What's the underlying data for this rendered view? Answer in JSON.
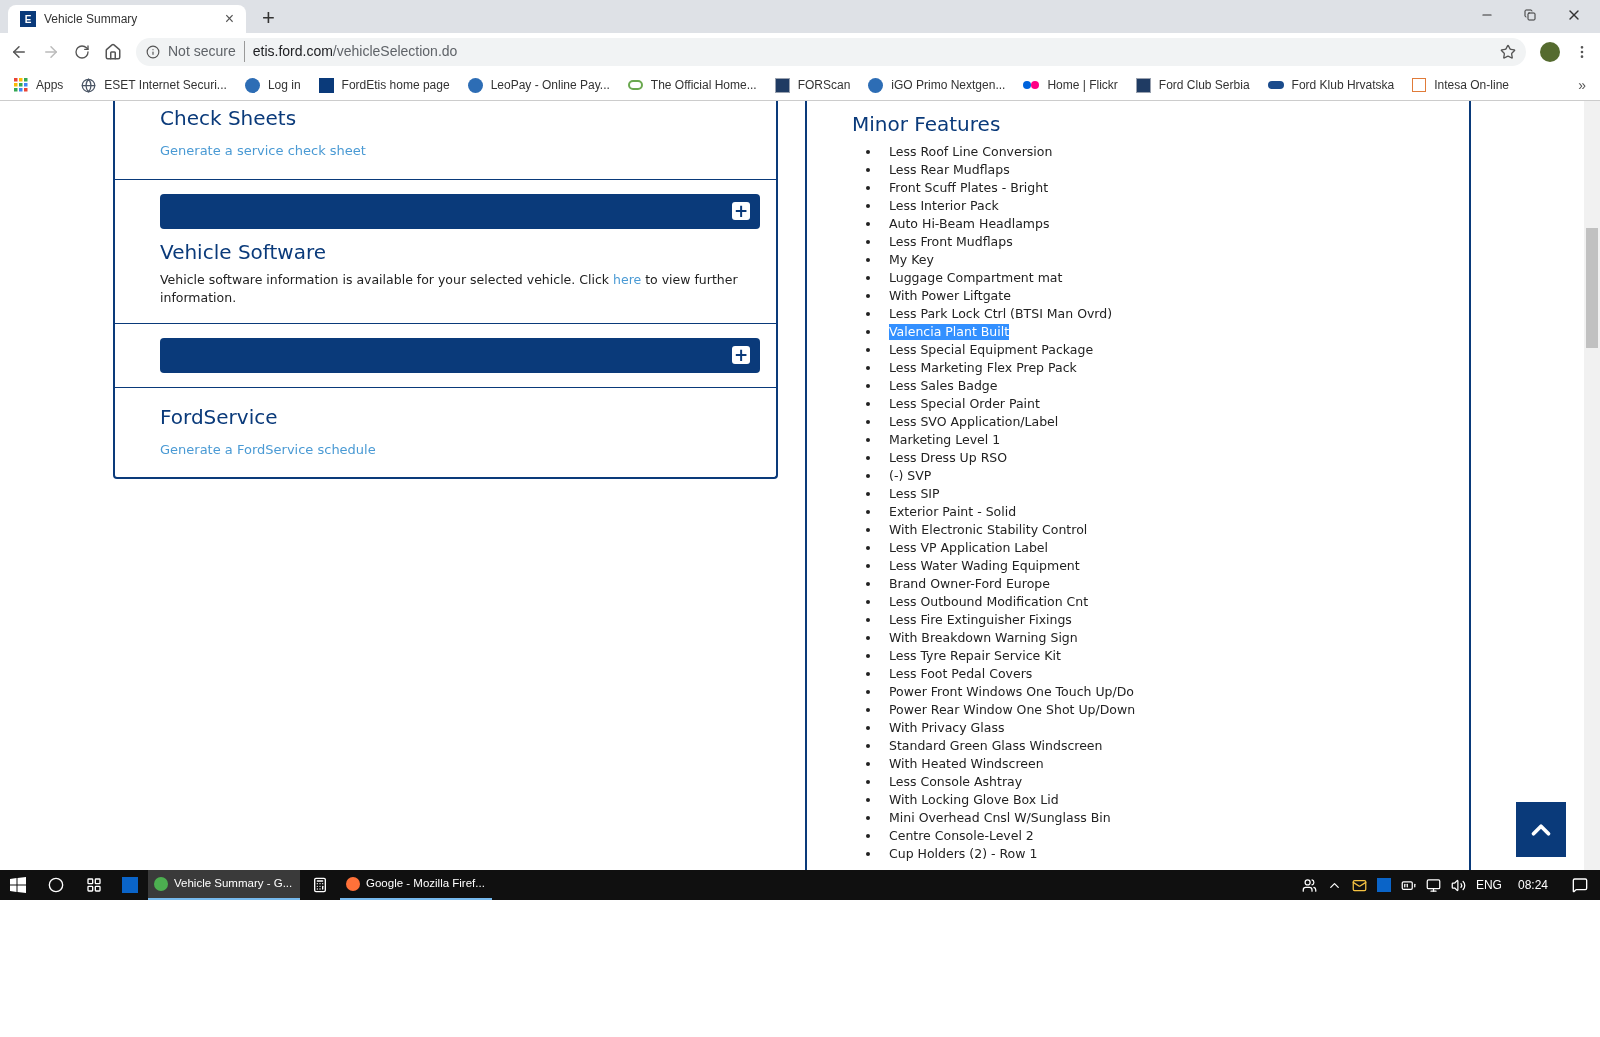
{
  "browser": {
    "tab": {
      "favicon": "E",
      "title": "Vehicle Summary",
      "close": "×"
    },
    "new_tab": "+",
    "address": {
      "security": "Not secure",
      "host": "etis.ford.com",
      "path": "/vehicleSelection.do"
    },
    "bookmarks": [
      {
        "label": "Apps",
        "kind": "grid"
      },
      {
        "label": "ESET Internet Securi...",
        "kind": "globe"
      },
      {
        "label": "Log in",
        "kind": "circle"
      },
      {
        "label": "FordEtis home page",
        "kind": "letter"
      },
      {
        "label": "LeoPay - Online Pay...",
        "kind": "circle"
      },
      {
        "label": "The Official Home...",
        "kind": "leaf"
      },
      {
        "label": "FORScan",
        "kind": "square"
      },
      {
        "label": "iGO Primo Nextgen...",
        "kind": "circle"
      },
      {
        "label": "Home | Flickr",
        "kind": "dots"
      },
      {
        "label": "Ford Club Serbia",
        "kind": "square"
      },
      {
        "label": "Ford Klub Hrvatska",
        "kind": "oval"
      },
      {
        "label": "Intesa On-line",
        "kind": "outline"
      }
    ],
    "more": "»"
  },
  "left_panel": {
    "sections": [
      {
        "kind": "link",
        "title": "Check Sheets",
        "link": "Generate a service check sheet"
      },
      {
        "kind": "bar",
        "expand": "+"
      },
      {
        "kind": "text",
        "title": "Vehicle Software",
        "before": "Vehicle software information is available for your selected vehicle. Click ",
        "link": "here",
        "after": " to view further information."
      },
      {
        "kind": "bar",
        "expand": "+"
      },
      {
        "kind": "link",
        "title": "FordService",
        "link": "Generate a FordService schedule"
      }
    ]
  },
  "right_panel": {
    "title": "Minor Features",
    "items": [
      {
        "label": "Less Roof Line Conversion",
        "highlighted": false
      },
      {
        "label": "Less Rear Mudflaps",
        "highlighted": false
      },
      {
        "label": "Front Scuff Plates - Bright",
        "highlighted": false
      },
      {
        "label": "Less Interior Pack",
        "highlighted": false
      },
      {
        "label": "Auto Hi-Beam Headlamps",
        "highlighted": false
      },
      {
        "label": "Less Front Mudflaps",
        "highlighted": false
      },
      {
        "label": "My Key",
        "highlighted": false
      },
      {
        "label": "Luggage Compartment mat",
        "highlighted": false
      },
      {
        "label": "With Power Liftgate",
        "highlighted": false
      },
      {
        "label": "Less Park Lock Ctrl (BTSI Man Ovrd)",
        "highlighted": false
      },
      {
        "label": "Valencia Plant Built",
        "highlighted": true
      },
      {
        "label": "Less Special Equipment Package",
        "highlighted": false
      },
      {
        "label": "Less Marketing Flex Prep Pack",
        "highlighted": false
      },
      {
        "label": "Less Sales Badge",
        "highlighted": false
      },
      {
        "label": "Less Special Order Paint",
        "highlighted": false
      },
      {
        "label": "Less SVO Application/Label",
        "highlighted": false
      },
      {
        "label": "Marketing Level 1",
        "highlighted": false
      },
      {
        "label": "Less Dress Up RSO",
        "highlighted": false
      },
      {
        "label": "(-) SVP",
        "highlighted": false
      },
      {
        "label": "Less SIP",
        "highlighted": false
      },
      {
        "label": "Exterior Paint - Solid",
        "highlighted": false
      },
      {
        "label": "With Electronic Stability Control",
        "highlighted": false
      },
      {
        "label": "Less VP Application Label",
        "highlighted": false
      },
      {
        "label": "Less Water Wading Equipment",
        "highlighted": false
      },
      {
        "label": "Brand Owner-Ford Europe",
        "highlighted": false
      },
      {
        "label": "Less Outbound Modification Cnt",
        "highlighted": false
      },
      {
        "label": "Less Fire Extinguisher Fixings",
        "highlighted": false
      },
      {
        "label": "With Breakdown Warning Sign",
        "highlighted": false
      },
      {
        "label": "Less Tyre Repair Service Kit",
        "highlighted": false
      },
      {
        "label": "Less Foot Pedal Covers",
        "highlighted": false
      },
      {
        "label": "Power Front Windows One Touch Up/Do",
        "highlighted": false
      },
      {
        "label": "Power Rear Window One Shot Up/Down",
        "highlighted": false
      },
      {
        "label": "With Privacy Glass",
        "highlighted": false
      },
      {
        "label": "Standard Green Glass Windscreen",
        "highlighted": false
      },
      {
        "label": "With Heated Windscreen",
        "highlighted": false
      },
      {
        "label": "Less Console Ashtray",
        "highlighted": false
      },
      {
        "label": "With Locking Glove Box Lid",
        "highlighted": false
      },
      {
        "label": "Mini Overhead Cnsl W/Sunglass Bin",
        "highlighted": false
      },
      {
        "label": "Centre Console-Level 2",
        "highlighted": false
      },
      {
        "label": "Cup Holders (2) - Row 1",
        "highlighted": false
      }
    ]
  },
  "taskbar": {
    "apps": [
      {
        "label": "Vehicle Summary - G...",
        "kind": "chrome",
        "active": true
      },
      {
        "label": "Google - Mozilla Firef...",
        "kind": "firefox",
        "active": false
      }
    ],
    "language": "ENG",
    "time": "08:24"
  }
}
